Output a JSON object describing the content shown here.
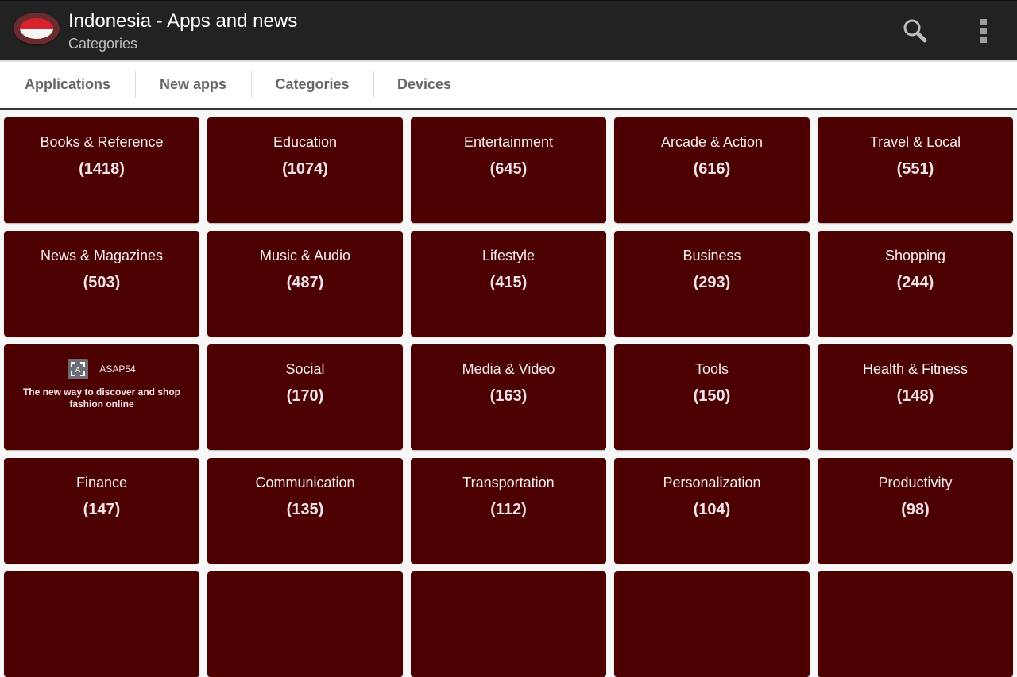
{
  "header": {
    "title": "Indonesia - Apps and news",
    "subtitle": "Categories",
    "logo_icon": "indonesia-flag-icon",
    "actions": [
      {
        "name": "search",
        "icon": "search-icon"
      },
      {
        "name": "overflow-menu",
        "icon": "more-vertical-icon"
      }
    ]
  },
  "tabs": [
    {
      "label": "Applications"
    },
    {
      "label": "New apps"
    },
    {
      "label": "Categories"
    },
    {
      "label": "Devices"
    }
  ],
  "categories": [
    {
      "name": "Books & Reference",
      "count": "(1418)"
    },
    {
      "name": "Education",
      "count": "(1074)"
    },
    {
      "name": "Entertainment",
      "count": "(645)"
    },
    {
      "name": "Arcade & Action",
      "count": "(616)"
    },
    {
      "name": "Travel & Local",
      "count": "(551)"
    },
    {
      "name": "News & Magazines",
      "count": "(503)"
    },
    {
      "name": "Music & Audio",
      "count": "(487)"
    },
    {
      "name": "Lifestyle",
      "count": "(415)"
    },
    {
      "name": "Business",
      "count": "(293)"
    },
    {
      "name": "Shopping",
      "count": "(244)"
    },
    {
      "name": "Social",
      "count": "(170)"
    },
    {
      "name": "Media & Video",
      "count": "(163)"
    },
    {
      "name": "Tools",
      "count": "(150)"
    },
    {
      "name": "Health & Fitness",
      "count": "(148)"
    },
    {
      "name": "Finance",
      "count": "(147)"
    },
    {
      "name": "Communication",
      "count": "(135)"
    },
    {
      "name": "Transportation",
      "count": "(112)"
    },
    {
      "name": "Personalization",
      "count": "(104)"
    },
    {
      "name": "Productivity",
      "count": "(98)"
    }
  ],
  "ad": {
    "brand": "ASAP54",
    "icon_letter": "A",
    "text": "The new way to discover and shop fashion online"
  },
  "colors": {
    "tile_bg": "#4d0000",
    "actionbar_bg": "#222222",
    "tab_text": "#666666"
  }
}
